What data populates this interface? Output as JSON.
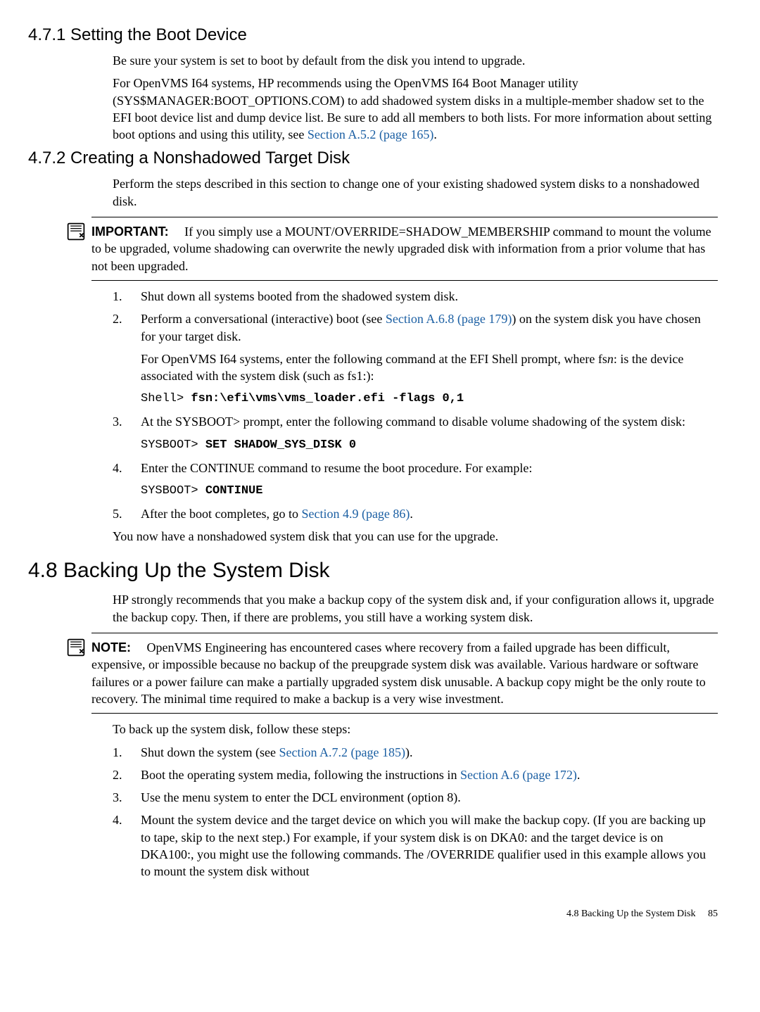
{
  "s471": {
    "heading": "4.7.1 Setting the Boot Device",
    "p1": "Be sure your system is set to boot by default from the disk you intend to upgrade.",
    "p2a": "For OpenVMS I64 systems, HP recommends using the OpenVMS I64 Boot Manager utility (SYS$MANAGER:BOOT_OPTIONS.COM) to add shadowed system disks in a multiple-member shadow set to the EFI boot device list and dump device list. Be sure to add all members to both lists. For more information about setting boot options and using this utility, see ",
    "p2link": "Section A.5.2 (page 165)",
    "p2b": "."
  },
  "s472": {
    "heading": "4.7.2 Creating a Nonshadowed Target Disk",
    "p1": "Perform the steps described in this section to change one of your existing shadowed system disks to a nonshadowed disk.",
    "important_label": "IMPORTANT:",
    "important_text": "If you simply use a MOUNT/OVERRIDE=SHADOW_MEMBERSHIP command to mount the volume to be upgraded, volume shadowing can overwrite the newly upgraded disk with information from a prior volume that has not been upgraded.",
    "li1": "Shut down all systems booted from the shadowed system disk.",
    "li2a": "Perform a conversational (interactive) boot (see ",
    "li2link": "Section A.6.8 (page 179)",
    "li2b": ") on the system disk you have chosen for your target disk.",
    "li2p2a": "For OpenVMS I64 systems, enter the following command at the EFI Shell prompt, where fs",
    "li2p2i": "n",
    "li2p2b": ": is the device associated with the system disk (such as fs1:):",
    "li2code_prompt": "Shell> ",
    "li2code_cmd": "fsn:\\efi\\vms\\vms_loader.efi -flags 0,1",
    "li3": "At the SYSBOOT> prompt, enter the following command to disable volume shadowing of the system disk:",
    "li3code_prompt": "SYSBOOT> ",
    "li3code_cmd": "SET SHADOW_SYS_DISK 0",
    "li4": "Enter the CONTINUE command to resume the boot procedure. For example:",
    "li4code_prompt": "SYSBOOT> ",
    "li4code_cmd": "CONTINUE",
    "li5a": "After the boot completes, go to ",
    "li5link": "Section 4.9 (page 86)",
    "li5b": ".",
    "closing": "You now have a nonshadowed system disk that you can use for the upgrade."
  },
  "s48": {
    "heading": "4.8 Backing Up the System Disk",
    "p1": "HP strongly recommends that you make a backup copy of the system disk and, if your configuration allows it, upgrade the backup copy. Then, if there are problems, you still have a working system disk.",
    "note_label": "NOTE:",
    "note_text": "OpenVMS Engineering has encountered cases where recovery from a failed upgrade has been difficult, expensive, or impossible because no backup of the preupgrade system disk was available. Various hardware or software failures or a power failure can make a partially upgraded system disk unusable. A backup copy might be the only route to recovery. The minimal time required to make a backup is a very wise investment.",
    "p2": "To back up the system disk, follow these steps:",
    "li1a": "Shut down the system (see ",
    "li1link": "Section A.7.2 (page 185)",
    "li1b": ").",
    "li2a": "Boot the operating system media, following the instructions in ",
    "li2link": "Section A.6 (page 172)",
    "li2b": ".",
    "li3": "Use the menu system to enter the DCL environment (option 8).",
    "li4": "Mount the system device and the target device on which you will make the backup copy. (If you are backing up to tape, skip to the next step.) For example, if your system disk is on DKA0: and the target device is on DKA100:, you might use the following commands. The /OVERRIDE qualifier used in this example allows you to mount the system disk without"
  },
  "footer": {
    "text": "4.8 Backing Up the System Disk",
    "page": "85"
  }
}
